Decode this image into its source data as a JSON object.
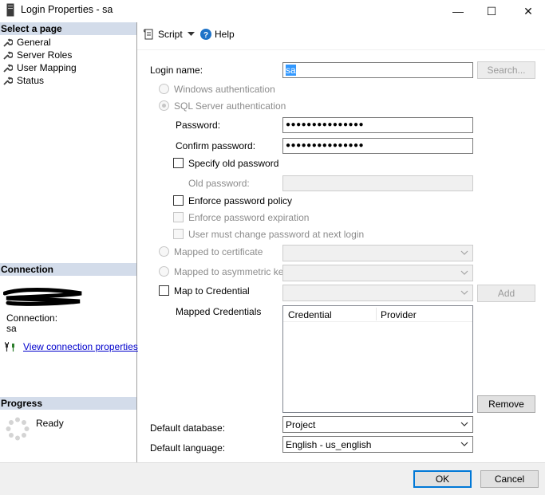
{
  "window": {
    "title": "Login Properties - sa",
    "minimize_glyph": "—",
    "maximize_glyph": "☐",
    "close_glyph": "✕"
  },
  "left": {
    "select_page_header": "Select a page",
    "pages": [
      {
        "label": "General",
        "icon": "wrench-icon"
      },
      {
        "label": "Server Roles",
        "icon": "wrench-icon"
      },
      {
        "label": "User Mapping",
        "icon": "wrench-icon"
      },
      {
        "label": "Status",
        "icon": "wrench-icon"
      }
    ],
    "connection_header": "Connection",
    "connection_label": "Connection:",
    "connection_value": "sa",
    "view_connection_link": "View connection properties",
    "progress_header": "Progress",
    "progress_status": "Ready"
  },
  "toolbar": {
    "script_label": "Script",
    "help_label": "Help"
  },
  "form": {
    "login_name_label": "Login name:",
    "login_name_value": "sa",
    "search_button": "Search...",
    "windows_auth_label": "Windows authentication",
    "sql_auth_label": "SQL Server authentication",
    "password_label": "Password:",
    "password_value": "●●●●●●●●●●●●●●●",
    "confirm_password_label": "Confirm password:",
    "confirm_password_value": "●●●●●●●●●●●●●●●",
    "specify_old_password_label": "Specify old password",
    "old_password_label": "Old password:",
    "enforce_policy_label": "Enforce password policy",
    "enforce_expiration_label": "Enforce password expiration",
    "must_change_label": "User must change password at next login",
    "mapped_certificate_label": "Mapped to certificate",
    "mapped_asymmetric_label": "Mapped to asymmetric key",
    "map_credential_label": "Map to Credential",
    "add_button": "Add",
    "mapped_credentials_label": "Mapped Credentials",
    "credentials_columns": [
      "Credential",
      "Provider"
    ],
    "remove_button": "Remove",
    "default_database_label": "Default database:",
    "default_database_value": "Project",
    "default_language_label": "Default language:",
    "default_language_value": "English - us_english"
  },
  "footer": {
    "ok_button": "OK",
    "cancel_button": "Cancel"
  },
  "colors": {
    "section_header_bg": "#d3dcea",
    "link": "#0000cc",
    "selection": "#3399ff",
    "help_icon": "#1e73c8",
    "ok_border": "#0078d7"
  }
}
